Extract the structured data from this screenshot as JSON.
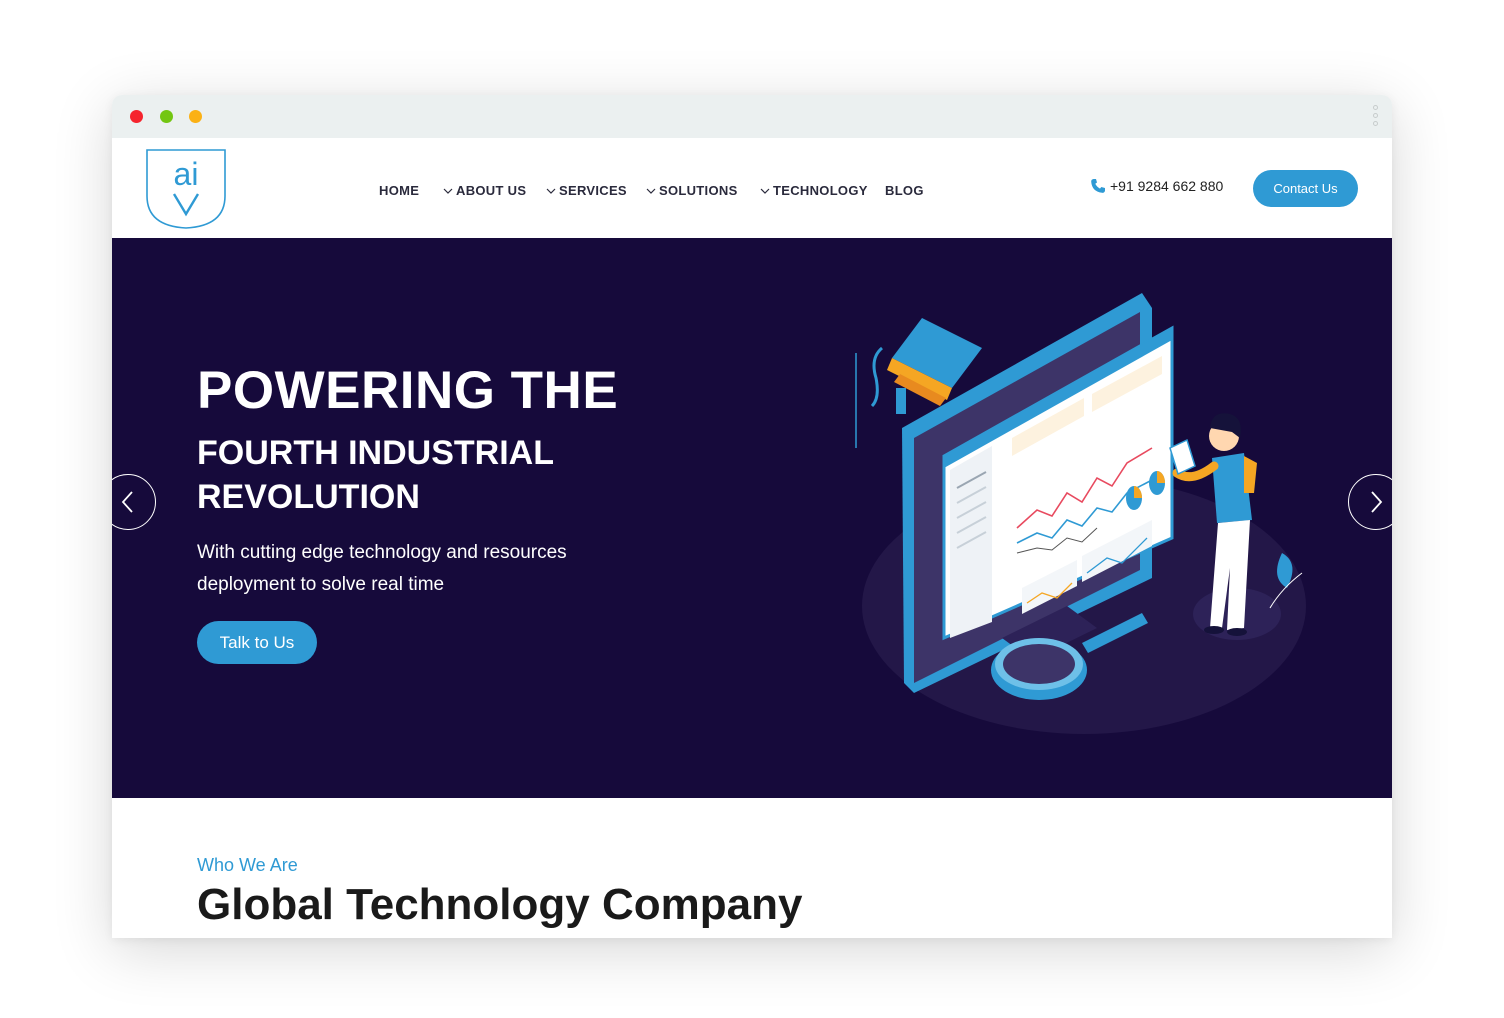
{
  "header": {
    "logo_alt": "ai v",
    "nav": [
      {
        "label": "HOME",
        "dropdown": false
      },
      {
        "label": "ABOUT US",
        "dropdown": true
      },
      {
        "label": "SERVICES",
        "dropdown": true
      },
      {
        "label": "SOLUTIONS",
        "dropdown": true
      },
      {
        "label": "TECHNOLOGY",
        "dropdown": true
      },
      {
        "label": "BLOG",
        "dropdown": false
      }
    ],
    "phone": "+91 9284 662 880",
    "contact_label": "Contact Us"
  },
  "hero": {
    "title_line1": "POWERING THE",
    "title_line2": "FOURTH INDUSTRIAL REVOLUTION",
    "subtitle": "With cutting edge technology and resources deployment to solve real time",
    "cta_label": "Talk to Us",
    "prev_icon": "chevron-left-icon",
    "next_icon": "chevron-right-icon"
  },
  "about": {
    "label": "Who We Are",
    "title": "Global Technology Company"
  },
  "colors": {
    "accent": "#2f9ad4",
    "hero_bg": "#160a3b",
    "orange": "#f5a623",
    "dot_red": "#f5242e",
    "dot_green": "#73c612",
    "dot_yellow": "#fbb115"
  }
}
